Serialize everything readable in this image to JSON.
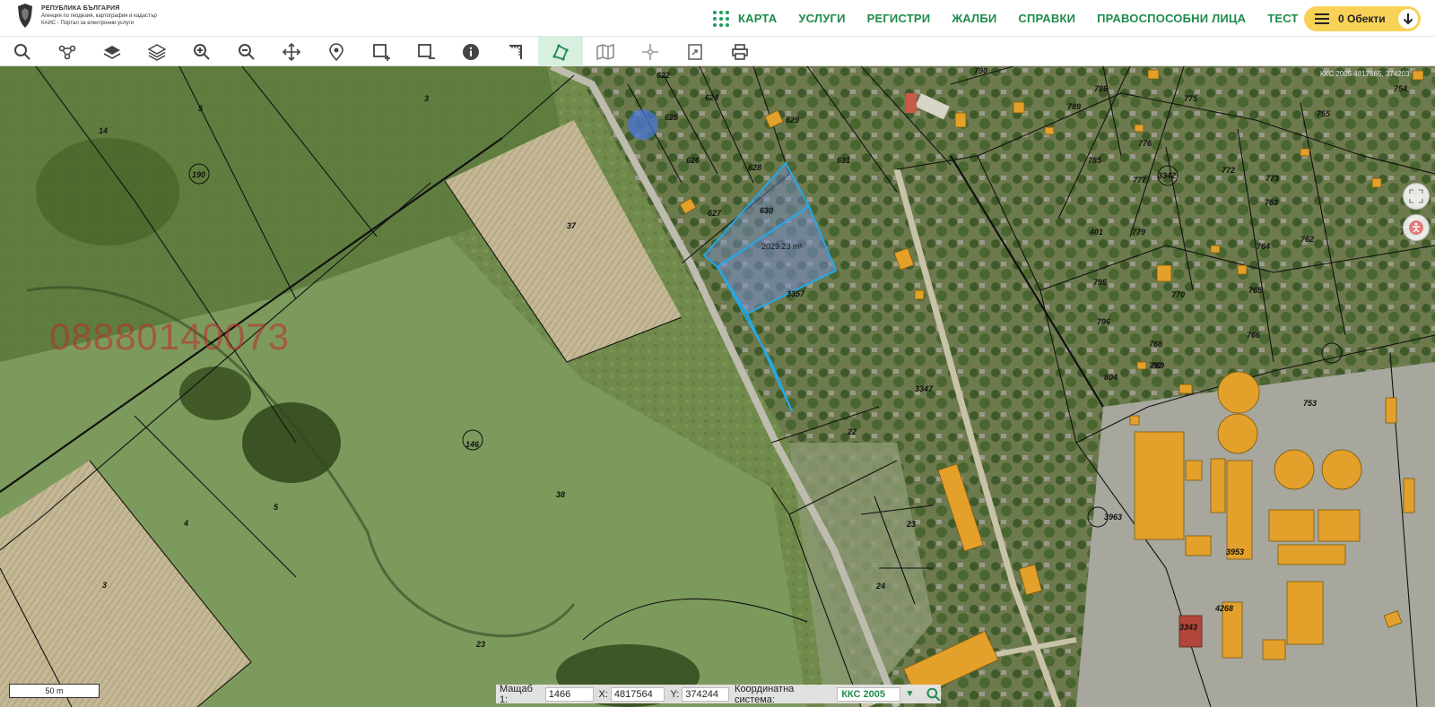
{
  "header": {
    "logo_line1": "РЕПУБЛИКА БЪЛГАРИЯ",
    "logo_line2": "Агенция по геодезия, картография и кадастър",
    "logo_line3": "КАИС - Портал за електронни услуги",
    "nav": [
      "КАРТА",
      "УСЛУГИ",
      "РЕГИСТРИ",
      "ЖАЛБИ",
      "СПРАВКИ",
      "ПРАВОСПОСОБНИ ЛИЦА",
      "ТЕСТ"
    ],
    "objects_label": "0 Обекти"
  },
  "toolbar": {
    "tools": [
      "search-icon",
      "route-icon",
      "layers-icon",
      "layers-stack-icon",
      "zoom-in-icon",
      "zoom-out-icon",
      "pan-icon",
      "location-pin-icon",
      "select-rectangle-add-icon",
      "select-rectangle-remove-icon",
      "info-icon",
      "measure-distance-icon",
      "measure-area-icon",
      "map-icon",
      "crosshair-icon",
      "export-icon",
      "print-icon"
    ],
    "active_tool": "measure-area-icon",
    "accent": "#1f8a4c"
  },
  "map": {
    "watermark": "08880140073",
    "measured_area": "2029.23 m²",
    "corner_text": "ККС 2005 4817665, 374203",
    "parcel_labels": [
      "3",
      "5",
      "14",
      "190",
      "37",
      "38",
      "4",
      "5",
      "3",
      "146",
      "23",
      "22",
      "23",
      "24",
      "3347",
      "3963",
      "3953",
      "630",
      "3357",
      "625",
      "626",
      "627",
      "628",
      "629",
      "631",
      "624",
      "622",
      "755",
      "775",
      "776",
      "777",
      "772",
      "773",
      "779",
      "763",
      "764",
      "765",
      "766",
      "768",
      "769",
      "770",
      "795",
      "796",
      "797",
      "804",
      "401",
      "3342",
      "3343",
      "4268",
      "753",
      "754",
      "756",
      "762",
      "785",
      "786",
      "789",
      "790"
    ]
  },
  "bottom": {
    "scale_text": "50 m",
    "scale_label": "Мащаб 1:",
    "scale_value": "1466",
    "x_label": "X:",
    "x_value": "4817564",
    "y_label": "Y:",
    "y_value": "374244",
    "crs_label": "Координатна система:",
    "crs_value": "ККС 2005"
  }
}
